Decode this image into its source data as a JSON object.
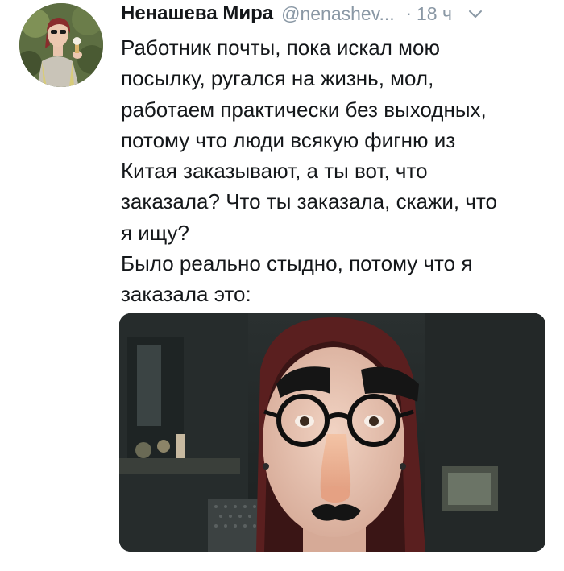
{
  "tweet": {
    "display_name": "Ненашева Мира",
    "handle": "@nenashev...",
    "separator": "·",
    "time": "18 ч",
    "text": "Работник почты, пока искал мою\nпосылку, ругался на жизнь, мол,\nработаем практически без выходных,\nпотому что люди всякую фигню из\nКитая заказывают, а ты вот, что\nзаказала? Что ты заказала, скажи, что\nя ищу?\nБыло реально стыдно, потому что я\nзаказала это:"
  },
  "icons": {
    "menu": "chevron-down-icon"
  },
  "colors": {
    "text": "#14171a",
    "secondary": "#8a98a5"
  }
}
